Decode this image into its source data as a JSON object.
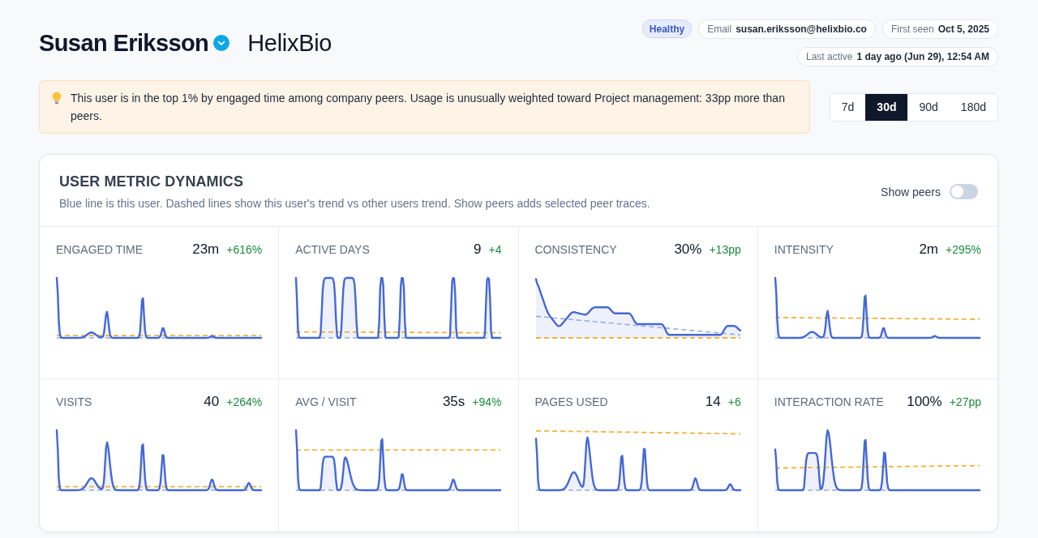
{
  "profile": {
    "name": "Susan Eriksson",
    "verified": true,
    "company": "HelixBio"
  },
  "status_badge": "Healthy",
  "meta_chips": [
    {
      "label": "Email",
      "value": "susan.eriksson@helixbio.co"
    },
    {
      "label": "First seen",
      "value": "Oct 5, 2025"
    },
    {
      "label": "Last active",
      "value": "1 day ago (Jun 29), 12:54 AM"
    }
  ],
  "insight_banner": {
    "text": "This user is in the top 1% by engaged time among company peers. Usage is unusually weighted toward Project management: 33pp more than peers."
  },
  "range_tabs": [
    {
      "label": "7d",
      "selected": false
    },
    {
      "label": "30d",
      "selected": true
    },
    {
      "label": "90d",
      "selected": false
    },
    {
      "label": "180d",
      "selected": false
    }
  ],
  "metrics_panel": {
    "title": "USER METRIC DYNAMICS",
    "subtitle": "Blue line is this user. Dashed lines show this user's trend vs other users trend. Show peers adds selected peer traces.",
    "show_peers": {
      "label": "Show peers",
      "on": false
    },
    "metrics": [
      {
        "label": "ENGAGED TIME",
        "value": "23m",
        "delta": "+616%"
      },
      {
        "label": "ACTIVE DAYS",
        "value": "9",
        "delta": "+4"
      },
      {
        "label": "CONSISTENCY",
        "value": "30%",
        "delta": "+13pp"
      },
      {
        "label": "INTENSITY",
        "value": "2m",
        "delta": "+295%"
      },
      {
        "label": "VISITS",
        "value": "40",
        "delta": "+264%"
      },
      {
        "label": "AVG / VISIT",
        "value": "35s",
        "delta": "+94%"
      },
      {
        "label": "PAGES USED",
        "value": "14",
        "delta": "+6"
      },
      {
        "label": "INTERACTION RATE",
        "value": "100%",
        "delta": "+27pp"
      }
    ]
  }
}
